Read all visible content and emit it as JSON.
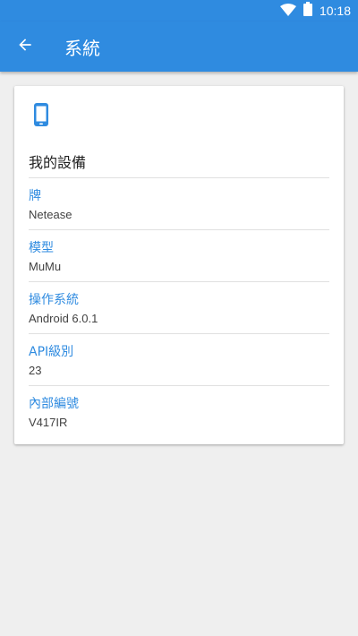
{
  "status_bar": {
    "time": "10:18",
    "wifi_icon": "wifi-icon",
    "battery_icon": "battery-icon"
  },
  "app_bar": {
    "back_icon": "arrow-back-icon",
    "title": "系統"
  },
  "card": {
    "icon": "smartphone-icon",
    "title": "我的設備",
    "items": [
      {
        "label": "牌",
        "value": "Netease"
      },
      {
        "label": "模型",
        "value": "MuMu"
      },
      {
        "label": "操作系統",
        "value": "Android 6.0.1"
      },
      {
        "label": "API級別",
        "value": "23"
      },
      {
        "label": "內部編號",
        "value": "V417IR"
      }
    ]
  },
  "colors": {
    "primary": "#2f8be0",
    "background": "#efefef",
    "card": "#ffffff",
    "divider": "#e0e0e0",
    "value_text": "#424242"
  }
}
